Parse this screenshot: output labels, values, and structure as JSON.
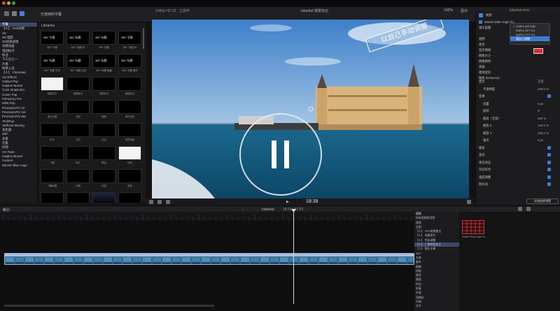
{
  "toolbar": {
    "library_header": "Libraries",
    "browser_filter": "已使用的字幕",
    "viewer_format": "1080p HD 25 · 立体声",
    "viewer_title": "Istanbul 渐变标记",
    "zoom": "100%",
    "view_menu": "显示",
    "inspector_title": "Istanbul.mov"
  },
  "sidebar": {
    "items": [
      {
        "label": "字幕",
        "selected": true
      },
      {
        "label": "【人】 VHS效果"
      },
      {
        "label": "3D"
      },
      {
        "label": "3D 电影"
      },
      {
        "label": "3D效果滤镜"
      },
      {
        "label": "动感动画"
      },
      {
        "label": "电视标识"
      },
      {
        "label": "标注"
      },
      {
        "label": "下三分之一"
      },
      {
        "label": "片尾"
      },
      {
        "label": "构建入出"
      },
      {
        "label": "【人】 Chromatic"
      },
      {
        "label": "CD Effects"
      },
      {
        "label": "Callout Pop"
      },
      {
        "label": "Caption Burner"
      },
      {
        "label": "Color Grade Bro"
      },
      {
        "label": "Comic Pop"
      },
      {
        "label": "FxFactory Pro"
      },
      {
        "label": "HDR Pop"
      },
      {
        "label": "PremiumVFX Gl"
      },
      {
        "label": "PremiumVFX Vol"
      },
      {
        "label": "PremiumVFX Wa"
      },
      {
        "label": "TechPop"
      },
      {
        "label": "XEffects Moving"
      },
      {
        "label": "发生器"
      },
      {
        "label": "360°"
      },
      {
        "label": "背景"
      },
      {
        "label": "元素"
      },
      {
        "label": "纹理"
      },
      {
        "label": "CD Paint"
      },
      {
        "label": "Caption Burner"
      },
      {
        "label": "Custom"
      },
      {
        "label": "Electric Blue Logo"
      }
    ]
  },
  "browser": {
    "thumbs": [
      {
        "title": "360° 字幕",
        "caption": "360° 字幕"
      },
      {
        "title": "360° 标题",
        "caption": "360° 标题 3D"
      },
      {
        "title": "360° 标题",
        "caption": "360° 标题"
      },
      {
        "title": "360° 字幕",
        "caption": "360° 字幕 3D"
      },
      {
        "title": "360° 标题",
        "caption": "360° 标题 文本"
      },
      {
        "title": "360° 标题",
        "caption": "360° 标题 引用"
      },
      {
        "title": "360° 标题",
        "caption": "360° 标题 横幅"
      },
      {
        "title": "360° 标题",
        "caption": "360° 标题 展开"
      },
      {
        "title": "",
        "caption": "标题文字",
        "style": "white"
      },
      {
        "title": "",
        "caption": "视频标注"
      },
      {
        "title": "",
        "caption": "动态标注"
      },
      {
        "title": "",
        "caption": "画面标注"
      },
      {
        "title": "",
        "caption": "流光字幕"
      },
      {
        "title": "",
        "caption": "光效"
      },
      {
        "title": "",
        "caption": "视角"
      },
      {
        "title": "",
        "caption": "城市风光"
      },
      {
        "title": "",
        "caption": "片头"
      },
      {
        "title": "",
        "caption": "交叉"
      },
      {
        "title": "",
        "caption": "天空"
      },
      {
        "title": "",
        "caption": "动态背景"
      },
      {
        "title": "",
        "caption": "飞溅"
      },
      {
        "title": "",
        "caption": "碎片"
      },
      {
        "title": "",
        "caption": "黑色"
      },
      {
        "title": "",
        "caption": "白色",
        "style": "white"
      },
      {
        "title": "",
        "caption": "飞舞标题"
      },
      {
        "title": "",
        "caption": "字幕"
      },
      {
        "title": "",
        "caption": "光线"
      },
      {
        "title": "",
        "caption": "渐变"
      },
      {
        "title": "",
        "caption": "三维"
      },
      {
        "title": "",
        "caption": "边框"
      },
      {
        "title": "",
        "caption": "蓝色",
        "style": "tint"
      },
      {
        "title": "",
        "caption": "扫光"
      },
      {
        "title": "",
        "caption": "上滑"
      },
      {
        "title": "",
        "caption": "山峦"
      },
      {
        "title": "",
        "caption": "文字"
      },
      {
        "title": "",
        "caption": "片尾"
      }
    ]
  },
  "viewer": {
    "overlay_text": "以自己手动调整",
    "timecode": "18:39",
    "play_state": "paused"
  },
  "inspector": {
    "tab_title": "视频",
    "plugin": "Mavrik Wide Angle Fix",
    "dropdown_label": "镜头配置",
    "dropdown_options": [
      "GoPro 4/5 0.56",
      "GoPro 12/7 0.4",
      "GoPro 17/7 0.2",
      "我自己调整"
    ],
    "rows": [
      {
        "label": "视野",
        "value": ""
      },
      {
        "label": "变形",
        "value": ""
      },
      {
        "label": "显示网格",
        "value": ""
      },
      {
        "label": "网格大小",
        "value": ""
      },
      {
        "label": "网格颜色",
        "value": ""
      },
      {
        "label": "高级",
        "value": ""
      },
      {
        "label": "视频变形",
        "value": ""
      },
      {
        "label": "缩放 (Enhance)",
        "value": ""
      }
    ],
    "sections": [
      {
        "label": "混合",
        "value": "正常"
      },
      {
        "label": "不透明度",
        "value": "100.0 %"
      },
      {
        "label": "变换",
        "value": ""
      },
      {
        "label": "位置",
        "value": "0 px"
      },
      {
        "label": "旋转",
        "value": "0°"
      },
      {
        "label": "缩放（全部）",
        "value": "100 %"
      },
      {
        "label": "缩放 X",
        "value": "100.0 %"
      },
      {
        "label": "缩放 Y",
        "value": "100.0 %"
      },
      {
        "label": "锚点",
        "value": "0 px"
      },
      {
        "label": "裁剪",
        "value": ""
      },
      {
        "label": "变形",
        "value": ""
      },
      {
        "label": "果冻效应",
        "value": ""
      },
      {
        "label": "空间符合",
        "value": ""
      },
      {
        "label": "速度调整",
        "value": ""
      },
      {
        "label": "防抖动",
        "value": ""
      }
    ],
    "save_button": "存储效果预置"
  },
  "timeline": {
    "index_label": "索引",
    "project_name": "Istanbul",
    "duration": "18:39 / 01:55",
    "clip_name": "Istanbul"
  },
  "effects": {
    "header": "视频",
    "items": [
      {
        "label": "所有视频和音频"
      },
      {
        "label": "视频"
      },
      {
        "label": "全部"
      },
      {
        "label": "【人】 VHS效果复古"
      },
      {
        "label": "【人】 电影胶片"
      },
      {
        "label": "【人】 色彩调整"
      },
      {
        "label": "【人】 广角畸变修正",
        "selected": true
      },
      {
        "label": "【人】 镜头光晕"
      },
      {
        "label": "360°"
      },
      {
        "label": "光源"
      },
      {
        "label": "基本"
      },
      {
        "label": "模糊"
      },
      {
        "label": "拼贴"
      },
      {
        "label": "颜色"
      },
      {
        "label": "漫画"
      },
      {
        "label": "怀旧"
      },
      {
        "label": "失真"
      },
      {
        "label": "外观"
      },
      {
        "label": "风格化"
      },
      {
        "label": "平铺"
      },
      {
        "label": "文字"
      }
    ],
    "preview_caption": "Mavrik Wide Angle Fix"
  },
  "colors": {
    "accent": "#3a7bd8",
    "clip": "#4a6e9a",
    "overlay_banner": "#ffffff"
  }
}
